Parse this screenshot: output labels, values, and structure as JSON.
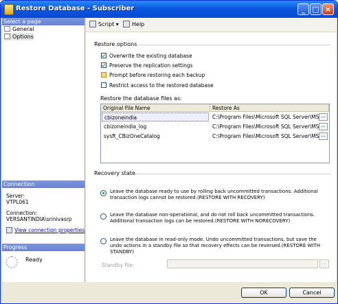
{
  "window": {
    "title": "Restore Database - Subscriber",
    "btn_min": "_",
    "btn_max": "□",
    "btn_close": "×"
  },
  "left": {
    "select_page_header": "Select a page",
    "pages": [
      {
        "label": "General"
      },
      {
        "label": "Options"
      }
    ],
    "connection_header": "Connection",
    "server_label": "Server:",
    "server_value": "VTPL061",
    "connection_label": "Connection:",
    "connection_value": "VERSANTINDIA\\srinivasrp",
    "view_connection_link": "View connection properties",
    "progress_header": "Progress",
    "progress_status": "Ready"
  },
  "toolbar": {
    "script_label": "Script",
    "script_arrow": "▾",
    "help_label": "Help"
  },
  "restore_options": {
    "group_label": "Restore options",
    "checkboxes": [
      {
        "label": "Overwrite the existing database",
        "checked": true
      },
      {
        "label": "Preserve the replication settings",
        "checked": true
      },
      {
        "label": "Prompt before restoring each backup",
        "checked": false
      },
      {
        "label": "Restrict access to the restored database",
        "checked": false
      }
    ],
    "files_label": "Restore the database files as:",
    "columns": [
      "Original File Name",
      "Restore As"
    ],
    "rows": [
      {
        "original": "cbizoneindia",
        "restore_as": "C:\\Program Files\\Microsoft SQL Server\\MS..."
      },
      {
        "original": "cbizoneindia_log",
        "restore_as": "C:\\Program Files\\Microsoft SQL Server\\MS..."
      },
      {
        "original": "sysft_CBizOneCatalog",
        "restore_as": "C:\\Program Files\\Microsoft SQL Server\\MS..."
      }
    ],
    "browse_label": "..."
  },
  "recovery": {
    "group_label": "Recovery state",
    "options": [
      {
        "text": "Leave the database ready to use by rolling back uncommitted transactions. Additional transaction logs cannot be restored.(RESTORE WITH RECOVERY)",
        "selected": true
      },
      {
        "text": "Leave the database non-operational, and do not roll back uncommitted transactions. Additional transaction logs can be restored.(RESTORE WITH NORECOVERY)",
        "selected": false
      },
      {
        "text": "Leave the database in read-only mode. Undo uncommitted transactions, but save the undo actions in a standby file so that recovery effects can be reversed.(RESTORE WITH STANDBY)",
        "selected": false
      }
    ],
    "standby_label": "Standby file:",
    "standby_value": "",
    "standby_browse": "..."
  },
  "footer": {
    "ok_label": "OK",
    "cancel_label": "Cancel"
  }
}
